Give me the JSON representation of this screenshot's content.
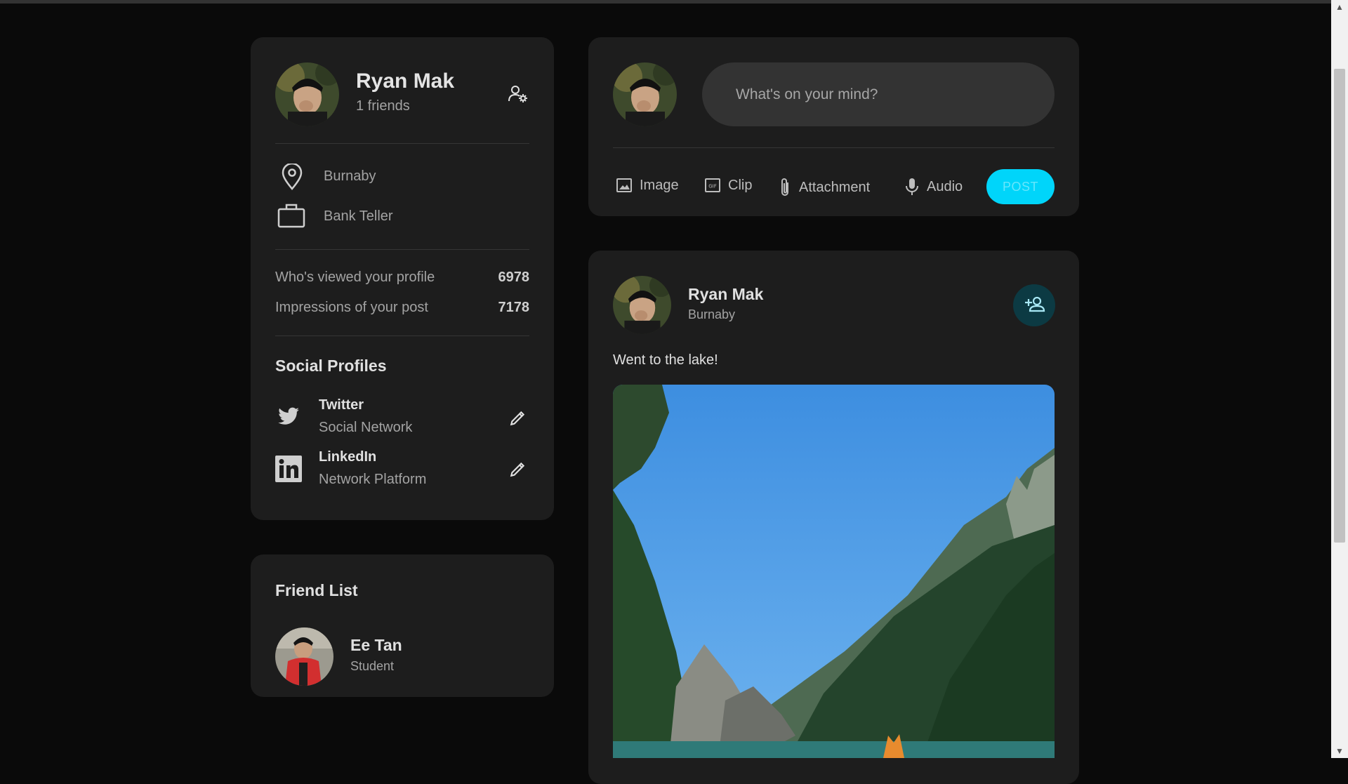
{
  "profile": {
    "name": "Ryan Mak",
    "friends": "1 friends",
    "location": "Burnaby",
    "occupation": "Bank Teller",
    "stats": [
      {
        "label": "Who's viewed your profile",
        "value": "6978"
      },
      {
        "label": "Impressions of your post",
        "value": "7178"
      }
    ],
    "social_title": "Social Profiles",
    "socials": [
      {
        "name": "Twitter",
        "type": "Social Network",
        "icon": "twitter-icon"
      },
      {
        "name": "LinkedIn",
        "type": "Network Platform",
        "icon": "linkedin-icon"
      }
    ]
  },
  "friend_list": {
    "title": "Friend List",
    "friends": [
      {
        "name": "Ee Tan",
        "subtitle": "Student"
      }
    ]
  },
  "composer": {
    "placeholder": "What's on your mind?",
    "buttons": [
      {
        "label": "Image",
        "icon": "image-icon"
      },
      {
        "label": "Clip",
        "icon": "gif-icon"
      },
      {
        "label": "Attachment",
        "icon": "paperclip-icon"
      },
      {
        "label": "Audio",
        "icon": "microphone-icon"
      }
    ],
    "post_label": "POST"
  },
  "feed": {
    "post": {
      "author": "Ryan Mak",
      "location": "Burnaby",
      "text": "Went to the lake!"
    }
  },
  "colors": {
    "accent": "#00d5fa",
    "card": "#1d1d1d",
    "background": "#0a0a0a"
  }
}
